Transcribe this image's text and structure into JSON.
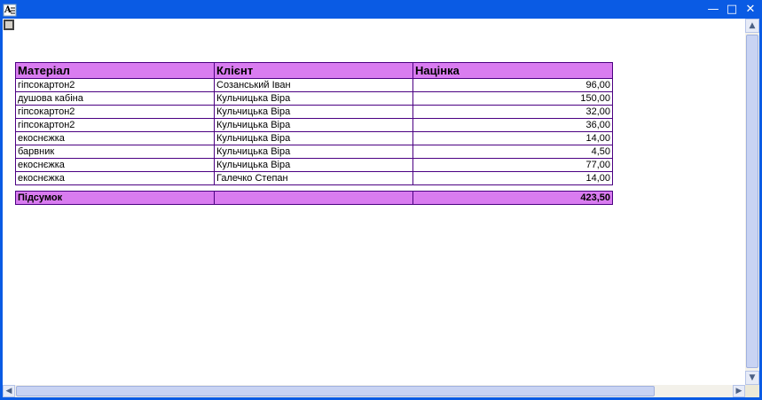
{
  "window": {
    "controls": {
      "minimize_icon": "minimize-icon",
      "maximize_icon": "maximize-icon",
      "close_icon": "close-icon"
    }
  },
  "report": {
    "columns": [
      "Матеріал",
      "Клієнт",
      "Націнка"
    ],
    "rows": [
      [
        "гіпсокартон2",
        "Созанський Іван",
        "96,00"
      ],
      [
        "душова кабіна",
        "Кульчицька Віра",
        "150,00"
      ],
      [
        "гіпсокартон2",
        "Кульчицька Віра",
        "32,00"
      ],
      [
        "гіпсокартон2",
        "Кульчицька Віра",
        "36,00"
      ],
      [
        "екоснєжка",
        "Кульчицька Віра",
        "14,00"
      ],
      [
        "барвник",
        "Кульчицька Віра",
        "4,50"
      ],
      [
        "екоснєжка",
        "Кульчицька Віра",
        "77,00"
      ],
      [
        "екоснєжка",
        "Галечко Степан",
        "14,00"
      ]
    ],
    "total": {
      "label": "Підсумок",
      "client": "",
      "value": "423,50"
    }
  },
  "colors": {
    "titlebar": "#0a5be4",
    "header_bg": "#d97cf0",
    "border": "#4b0082"
  }
}
